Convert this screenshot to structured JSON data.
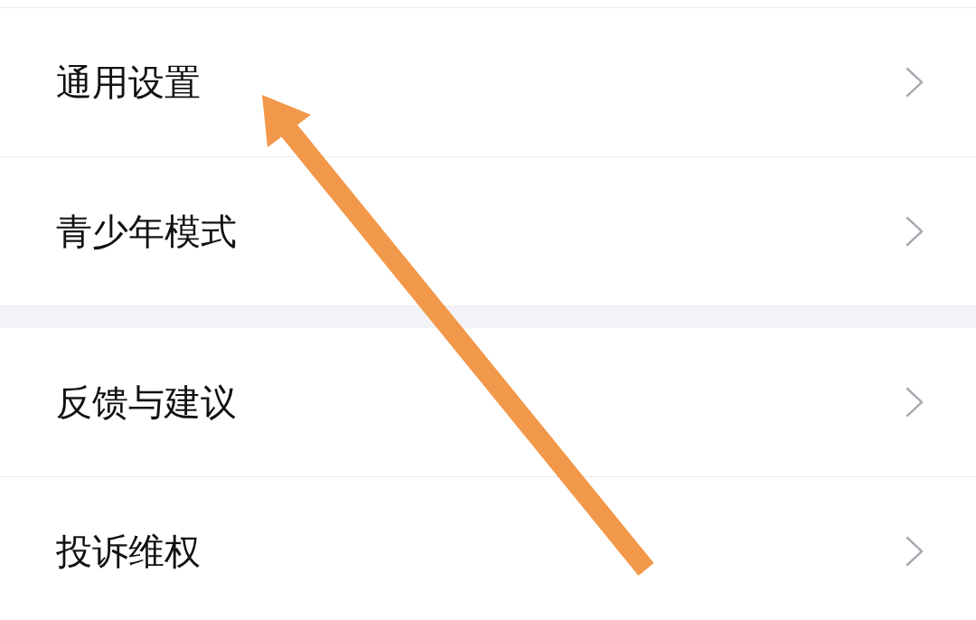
{
  "sections": [
    {
      "items": [
        {
          "label": "通用设置"
        },
        {
          "label": "青少年模式"
        }
      ]
    },
    {
      "items": [
        {
          "label": "反馈与建议"
        },
        {
          "label": "投诉维权"
        }
      ]
    }
  ]
}
